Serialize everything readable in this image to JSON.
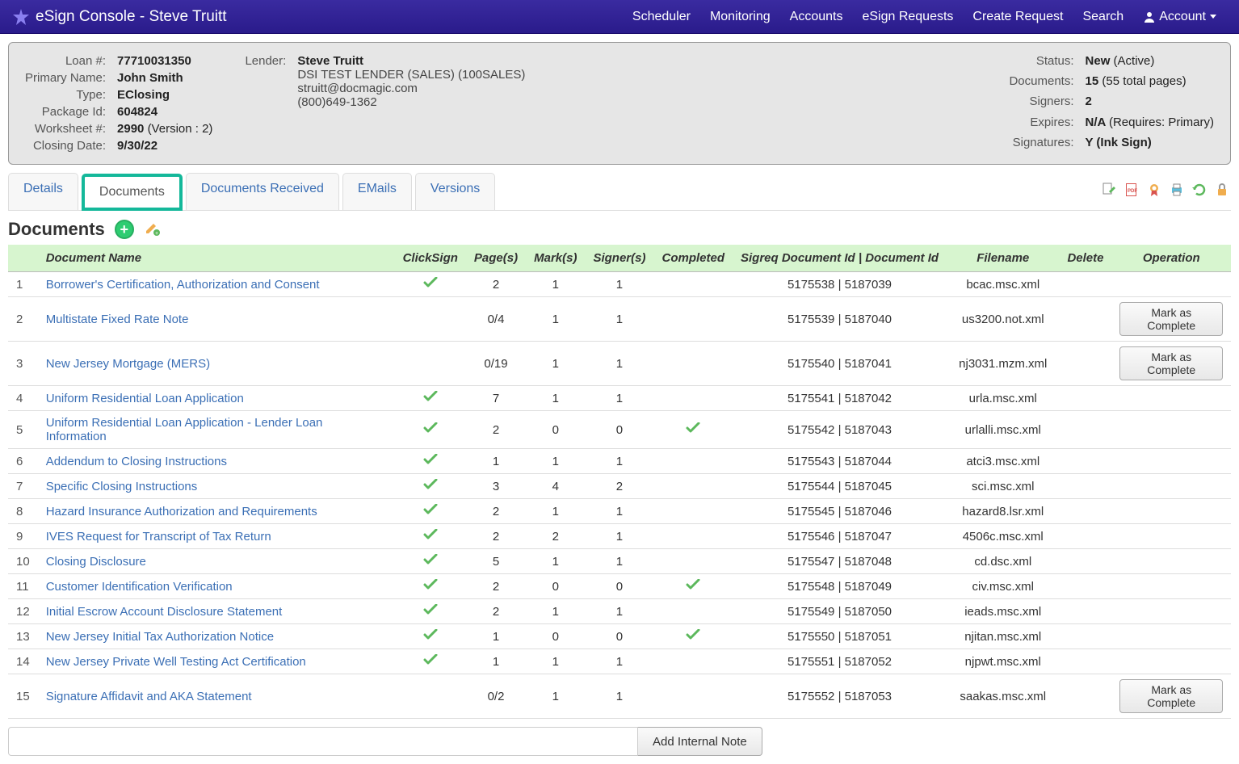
{
  "nav": {
    "brand": "eSign Console - Steve Truitt",
    "links": [
      "Scheduler",
      "Monitoring",
      "Accounts",
      "eSign Requests",
      "Create Request",
      "Search"
    ],
    "account": "Account"
  },
  "info": {
    "left": {
      "loan_label": "Loan #:",
      "loan": "77710031350",
      "name_label": "Primary Name:",
      "name": "John Smith",
      "type_label": "Type:",
      "type": "EClosing",
      "pkg_label": "Package Id:",
      "pkg": "604824",
      "ws_label": "Worksheet #:",
      "ws": "2990",
      "ws_suffix": "(Version : 2)",
      "close_label": "Closing Date:",
      "close": "9/30/22"
    },
    "center": {
      "lender_label": "Lender:",
      "lender": "Steve Truitt",
      "company": "DSI TEST LENDER (SALES) (100SALES)",
      "email": "struitt@docmagic.com",
      "phone": "(800)649-1362"
    },
    "right": {
      "status_label": "Status:",
      "status": "New",
      "status_suffix": "(Active)",
      "docs_label": "Documents:",
      "docs": "15",
      "docs_suffix": "(55 total pages)",
      "signers_label": "Signers:",
      "signers": "2",
      "expires_label": "Expires:",
      "expires": "N/A",
      "expires_suffix": "(Requires: Primary)",
      "sig_label": "Signatures:",
      "sig": "Y (Ink Sign)"
    }
  },
  "tabs": {
    "items": [
      "Details",
      "Documents",
      "Documents Received",
      "EMails",
      "Versions"
    ],
    "active": 1
  },
  "section": {
    "title": "Documents"
  },
  "table": {
    "headers": {
      "idx": "",
      "name": "Document Name",
      "clicksign": "ClickSign",
      "pages": "Page(s)",
      "marks": "Mark(s)",
      "signers": "Signer(s)",
      "completed": "Completed",
      "ids": "Sigreq Document Id | Document Id",
      "filename": "Filename",
      "delete": "Delete",
      "operation": "Operation"
    },
    "rows": [
      {
        "idx": "1",
        "name": "Borrower's Certification, Authorization and Consent",
        "cs": true,
        "pages": "2",
        "marks": "1",
        "signers": "1",
        "completed": false,
        "ids": "5175538 | 5187039",
        "file": "bcac.msc.xml",
        "op": ""
      },
      {
        "idx": "2",
        "name": "Multistate Fixed Rate Note",
        "cs": false,
        "pages": "0/4",
        "marks": "1",
        "signers": "1",
        "completed": false,
        "ids": "5175539 | 5187040",
        "file": "us3200.not.xml",
        "op": "Mark as Complete"
      },
      {
        "idx": "3",
        "name": "New Jersey Mortgage (MERS)",
        "cs": false,
        "pages": "0/19",
        "marks": "1",
        "signers": "1",
        "completed": false,
        "ids": "5175540 | 5187041",
        "file": "nj3031.mzm.xml",
        "op": "Mark as Complete"
      },
      {
        "idx": "4",
        "name": "Uniform Residential Loan Application",
        "cs": true,
        "pages": "7",
        "marks": "1",
        "signers": "1",
        "completed": false,
        "ids": "5175541 | 5187042",
        "file": "urla.msc.xml",
        "op": ""
      },
      {
        "idx": "5",
        "name": "Uniform Residential Loan Application - Lender Loan Information",
        "cs": true,
        "pages": "2",
        "marks": "0",
        "signers": "0",
        "completed": true,
        "ids": "5175542 | 5187043",
        "file": "urlalli.msc.xml",
        "op": ""
      },
      {
        "idx": "6",
        "name": "Addendum to Closing Instructions",
        "cs": true,
        "pages": "1",
        "marks": "1",
        "signers": "1",
        "completed": false,
        "ids": "5175543 | 5187044",
        "file": "atci3.msc.xml",
        "op": ""
      },
      {
        "idx": "7",
        "name": "Specific Closing Instructions",
        "cs": true,
        "pages": "3",
        "marks": "4",
        "signers": "2",
        "completed": false,
        "ids": "5175544 | 5187045",
        "file": "sci.msc.xml",
        "op": ""
      },
      {
        "idx": "8",
        "name": "Hazard Insurance Authorization and Requirements",
        "cs": true,
        "pages": "2",
        "marks": "1",
        "signers": "1",
        "completed": false,
        "ids": "5175545 | 5187046",
        "file": "hazard8.lsr.xml",
        "op": ""
      },
      {
        "idx": "9",
        "name": "IVES Request for Transcript of Tax Return",
        "cs": true,
        "pages": "2",
        "marks": "2",
        "signers": "1",
        "completed": false,
        "ids": "5175546 | 5187047",
        "file": "4506c.msc.xml",
        "op": ""
      },
      {
        "idx": "10",
        "name": "Closing Disclosure",
        "cs": true,
        "pages": "5",
        "marks": "1",
        "signers": "1",
        "completed": false,
        "ids": "5175547 | 5187048",
        "file": "cd.dsc.xml",
        "op": ""
      },
      {
        "idx": "11",
        "name": "Customer Identification Verification",
        "cs": true,
        "pages": "2",
        "marks": "0",
        "signers": "0",
        "completed": true,
        "ids": "5175548 | 5187049",
        "file": "civ.msc.xml",
        "op": ""
      },
      {
        "idx": "12",
        "name": "Initial Escrow Account Disclosure Statement",
        "cs": true,
        "pages": "2",
        "marks": "1",
        "signers": "1",
        "completed": false,
        "ids": "5175549 | 5187050",
        "file": "ieads.msc.xml",
        "op": ""
      },
      {
        "idx": "13",
        "name": "New Jersey Initial Tax Authorization Notice",
        "cs": true,
        "pages": "1",
        "marks": "0",
        "signers": "0",
        "completed": true,
        "ids": "5175550 | 5187051",
        "file": "njitan.msc.xml",
        "op": ""
      },
      {
        "idx": "14",
        "name": "New Jersey Private Well Testing Act Certification",
        "cs": true,
        "pages": "1",
        "marks": "1",
        "signers": "1",
        "completed": false,
        "ids": "5175551 | 5187052",
        "file": "njpwt.msc.xml",
        "op": ""
      },
      {
        "idx": "15",
        "name": "Signature Affidavit and AKA Statement",
        "cs": false,
        "pages": "0/2",
        "marks": "1",
        "signers": "1",
        "completed": false,
        "ids": "5175552 | 5187053",
        "file": "saakas.msc.xml",
        "op": "Mark as Complete"
      }
    ]
  },
  "note": {
    "button": "Add Internal Note",
    "placeholder": ""
  }
}
